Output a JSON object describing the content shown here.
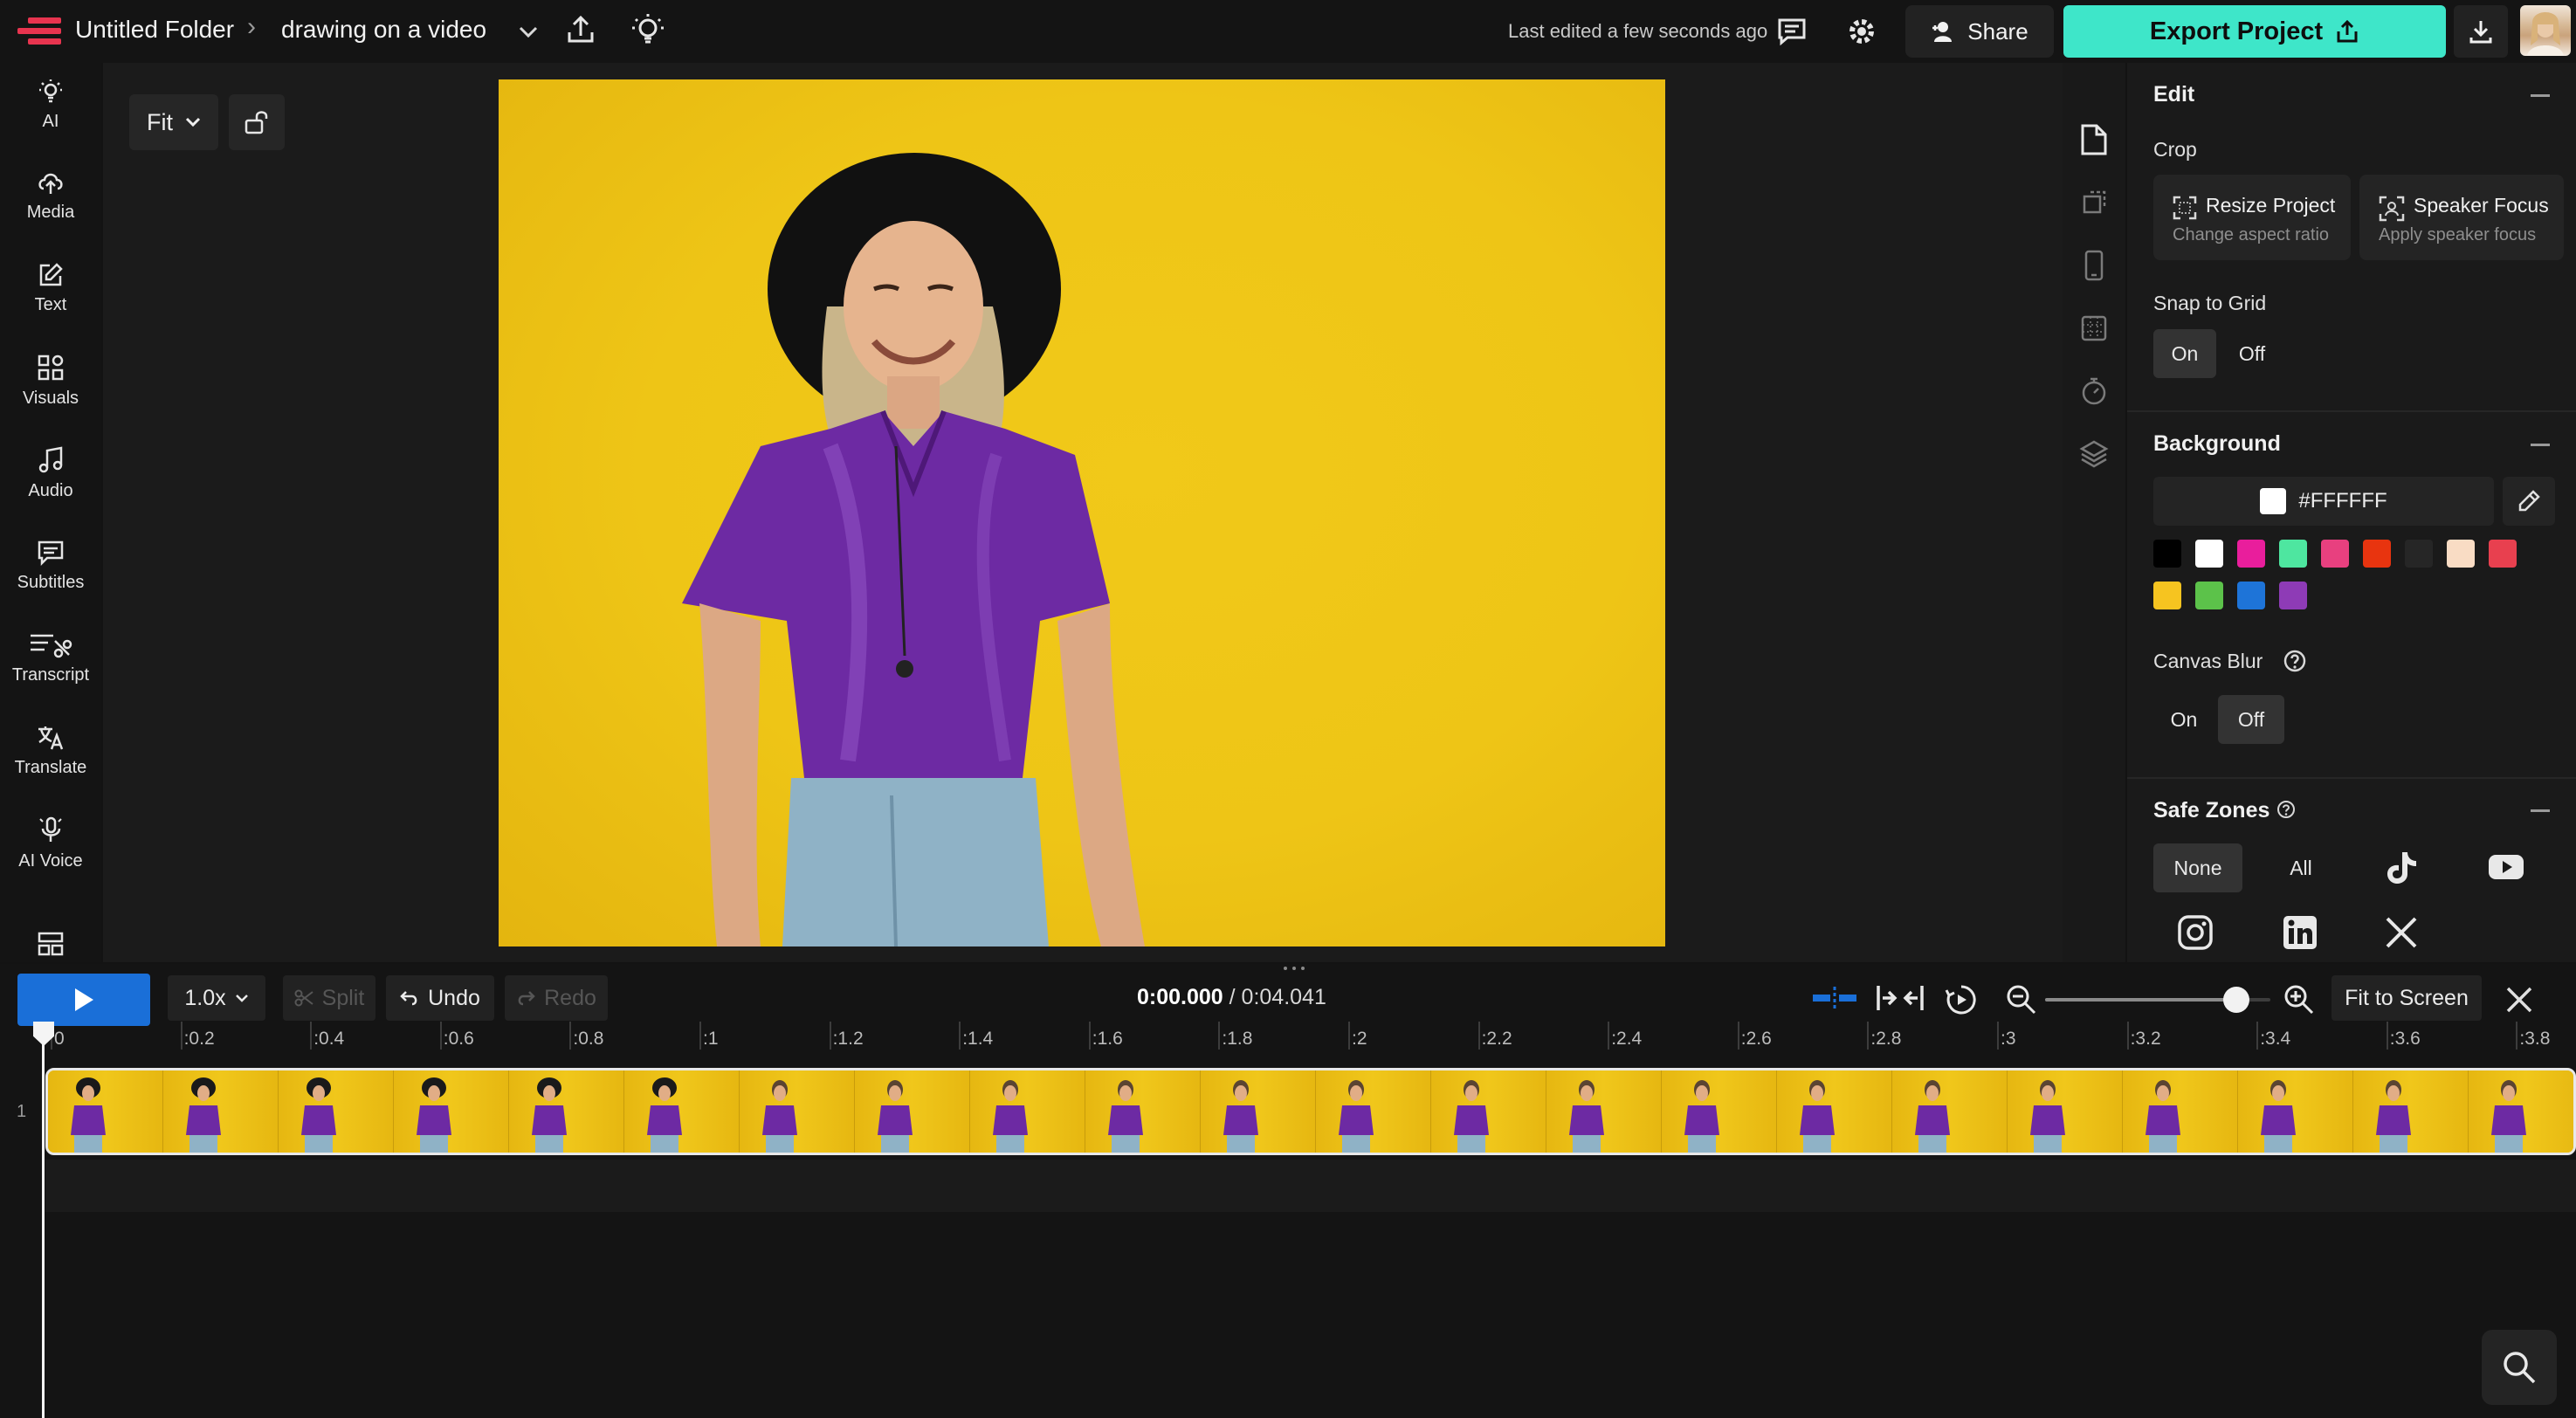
{
  "header": {
    "folder": "Untitled Folder",
    "project_name": "drawing on a video",
    "last_edited": "Last edited a few seconds ago",
    "share_label": "Share",
    "export_label": "Export Project"
  },
  "sidebar": {
    "items": [
      {
        "label": "AI",
        "icon": "bulb-icon"
      },
      {
        "label": "Media",
        "icon": "upload-cloud-icon"
      },
      {
        "label": "Text",
        "icon": "edit-icon"
      },
      {
        "label": "Visuals",
        "icon": "shapes-icon"
      },
      {
        "label": "Audio",
        "icon": "music-note-icon"
      },
      {
        "label": "Subtitles",
        "icon": "subtitles-icon"
      },
      {
        "label": "Transcript",
        "icon": "transcript-icon"
      },
      {
        "label": "Translate",
        "icon": "translate-icon"
      },
      {
        "label": "AI Voice",
        "icon": "microphone-icon"
      }
    ]
  },
  "canvas": {
    "fit_label": "Fit"
  },
  "panel": {
    "edit_heading": "Edit",
    "crop_label": "Crop",
    "resize_title": "Resize Project",
    "resize_sub": "Change aspect ratio",
    "speaker_title": "Speaker Focus",
    "speaker_sub": "Apply speaker focus",
    "snap_label": "Snap to Grid",
    "snap_on": "On",
    "snap_off": "Off",
    "background_heading": "Background",
    "bg_hex": "#FFFFFF",
    "swatches": [
      "#000000",
      "#ffffff",
      "#e91e9c",
      "#4ee6a0",
      "#e8407f",
      "#e8340f",
      "#262626",
      "#f9dcc4",
      "#e8404f",
      "#f6c420",
      "#5cc24a",
      "#1e74d8",
      "#8e3bb6"
    ],
    "blur_label": "Canvas Blur",
    "blur_on": "On",
    "blur_off": "Off",
    "safe_heading": "Safe Zones",
    "safe_none": "None",
    "safe_all": "All"
  },
  "timeline": {
    "speed": "1.0x",
    "split_label": "Split",
    "undo_label": "Undo",
    "redo_label": "Redo",
    "current_time": "0:00.000",
    "duration": "/ 0:04.041",
    "fit_screen_label": "Fit to Screen",
    "zoom_level": 0.85,
    "track_number": "1",
    "ticks": [
      "0",
      ":0.2",
      ":0.4",
      ":0.6",
      ":0.8",
      ":1",
      ":1.2",
      ":1.4",
      ":1.6",
      ":1.8",
      ":2",
      ":2.2",
      ":2.4",
      ":2.6",
      ":2.8",
      ":3",
      ":3.2",
      ":3.4",
      ":3.6",
      ":3.8"
    ]
  }
}
